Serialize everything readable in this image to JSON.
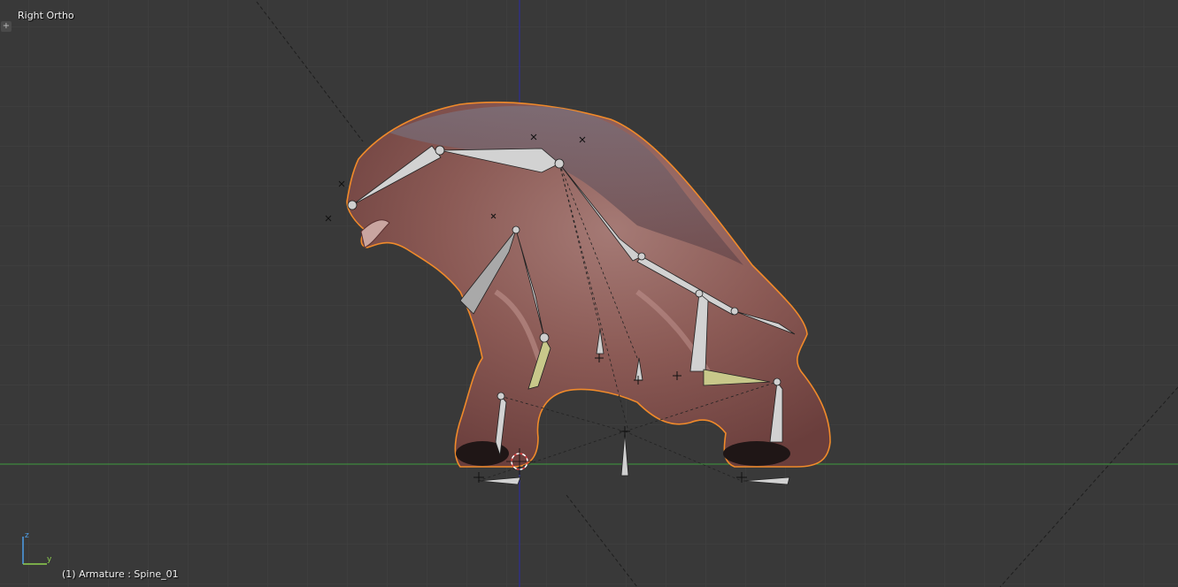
{
  "viewport": {
    "view_name": "Right Ortho",
    "status": "(1) Armature : Spine_01",
    "toggle_glyph": "+"
  },
  "axis_gizmo": {
    "z_label": "z",
    "y_label": "y"
  },
  "colors": {
    "background": "#393939",
    "grid": "#434343",
    "vertical_axis": "#2a2aa0",
    "horizontal_axis": "#3f9a3f",
    "selection_outline": "#f08a2a",
    "mesh_skin": "#8a5a55",
    "bone": "#c9c9c9",
    "bone_selected": "#c8c88a"
  }
}
